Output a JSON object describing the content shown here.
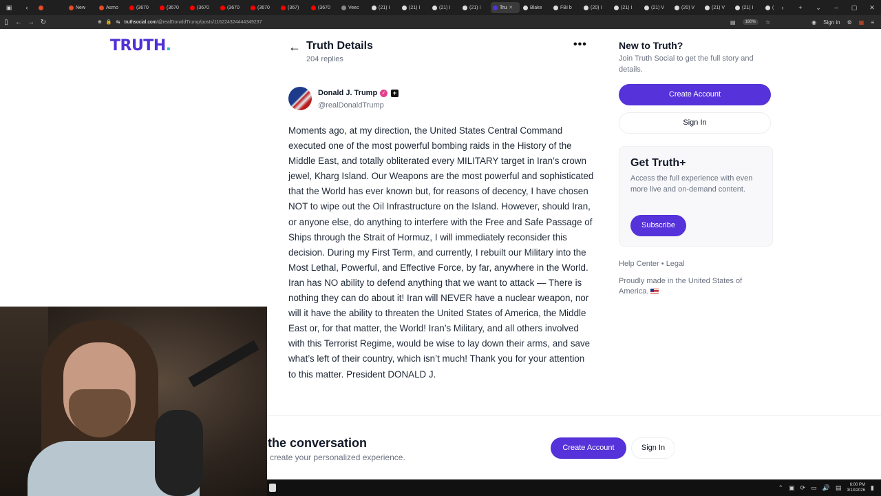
{
  "browser": {
    "tabs": [
      {
        "label": "",
        "color": "#e34c26"
      },
      {
        "label": "New",
        "color": "#e34c26"
      },
      {
        "label": "Asmo",
        "color": "#e34c26"
      },
      {
        "label": "(3670",
        "color": "#ff0000"
      },
      {
        "label": "(3670",
        "color": "#ff0000"
      },
      {
        "label": "(3670",
        "color": "#ff0000"
      },
      {
        "label": "(3670",
        "color": "#ff0000"
      },
      {
        "label": "(3670",
        "color": "#ff0000"
      },
      {
        "label": "(367)",
        "color": "#ff0000"
      },
      {
        "label": "(3670",
        "color": "#ff0000"
      },
      {
        "label": "Veec",
        "color": "#888888"
      },
      {
        "label": "(21) I",
        "color": "#dddddd"
      },
      {
        "label": "(21) I",
        "color": "#dddddd"
      },
      {
        "label": "(21) I",
        "color": "#dddddd"
      },
      {
        "label": "(21) I",
        "color": "#dddddd"
      },
      {
        "label": "Tru",
        "color": "#5532d9",
        "active": true
      },
      {
        "label": "Blake",
        "color": "#dddddd"
      },
      {
        "label": "FBI b",
        "color": "#dddddd"
      },
      {
        "label": "(20) I",
        "color": "#dddddd"
      },
      {
        "label": "(21) I",
        "color": "#dddddd"
      },
      {
        "label": "(21) V",
        "color": "#dddddd"
      },
      {
        "label": "(20) V",
        "color": "#dddddd"
      },
      {
        "label": "(21) V",
        "color": "#dddddd"
      },
      {
        "label": "(21) I",
        "color": "#dddddd"
      },
      {
        "label": "(20) I",
        "color": "#dddddd"
      },
      {
        "label": "(21) I",
        "color": "#dddddd"
      },
      {
        "label": "(14) I",
        "color": "#dddddd"
      },
      {
        "label": "(21) I",
        "color": "#dddddd"
      },
      {
        "label": "(21) I",
        "color": "#dddddd"
      },
      {
        "label": "(21",
        "color": "#dddddd"
      }
    ],
    "url_host": "truthsocial.com",
    "url_path": "/@realDonaldTrump/posts/116224324444349237",
    "zoom": "160%",
    "sign_in": "Sign in"
  },
  "site": {
    "logo": "TRUTH",
    "logo_dot": "."
  },
  "detail": {
    "back": "←",
    "title": "Truth Details",
    "replies": "204 replies",
    "more": "•••"
  },
  "post": {
    "author_name": "Donald J. Trump",
    "author_handle": "@realDonaldTrump",
    "body": "Moments ago, at my direction, the United States Central Command executed one of the most powerful bombing raids in the History of the Middle East, and totally obliterated every MILITARY target in Iran’s crown jewel, Kharg Island. Our Weapons are the most powerful and sophisticated that the World has ever known but, for reasons of decency, I have chosen NOT to wipe out the Oil Infrastructure on the Island. However, should Iran, or anyone else, do anything to interfere with the Free and Safe Passage of Ships through the Strait of Hormuz, I will immediately reconsider this decision. During my First Term, and currently, I rebuilt our Military into the Most Lethal, Powerful, and Effective Force, by far, anywhere in the World. Iran has NO ability to defend anything that we want to attack — There is nothing they can do about it! Iran will NEVER have a nuclear weapon, nor will it have the ability to threaten the United States of America, the Middle East or, for that matter, the World! Iran’s Military, and all others involved with this Terrorist Regime, would be wise to lay down their arms, and save what’s left of their country, which isn’t much! Thank you for your attention to this matter. President DONALD J."
  },
  "sidebar": {
    "new_title": "New to Truth?",
    "new_sub": "Join Truth Social to get the full story and details.",
    "create_account": "Create Account",
    "sign_in": "Sign In",
    "plus_title": "Get Truth+",
    "plus_text": "Access the full experience with even more live and on-demand content.",
    "subscribe": "Subscribe",
    "help_center": "Help Center",
    "bullet": "•",
    "legal": "Legal",
    "made_in": "Proudly made in the United States of America."
  },
  "banner": {
    "title": "the conversation",
    "sub": "create your personalized experience.",
    "create_account": "Create Account",
    "sign_in": "Sign In"
  },
  "taskbar": {
    "time": "6:00 PM",
    "date": "3/13/2026"
  },
  "colors": {
    "brand": "#5532d9",
    "logo": "#4f2fd6",
    "logo_dot": "#28c0c9",
    "verified": "#e43f8d"
  }
}
